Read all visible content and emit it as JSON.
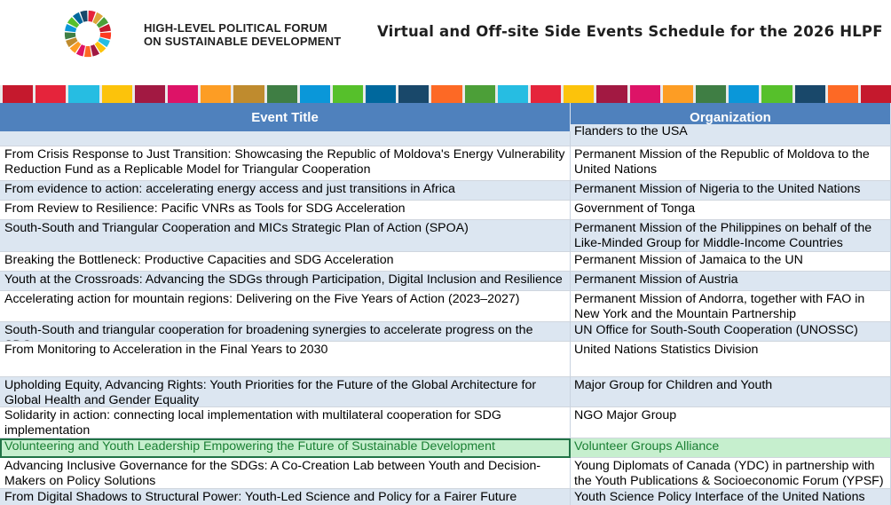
{
  "header": {
    "org_line1": "HIGH-LEVEL POLITICAL FORUM",
    "org_line2": "ON SUSTAINABLE DEVELOPMENT",
    "title": "Virtual and Off-site Side Events Schedule for the 2026 HLPF"
  },
  "sdg_colors": [
    "#e5243b",
    "#dda63a",
    "#4c9f38",
    "#c5192d",
    "#ff3a21",
    "#26bde2",
    "#fcc30b",
    "#a21942",
    "#fd6925",
    "#dd1367",
    "#fd9d24",
    "#bf8b2e",
    "#3f7e44",
    "#0a97d9",
    "#56c02b",
    "#00689d",
    "#19486a"
  ],
  "stripe_colors": [
    "#c5192d",
    "#e5243b",
    "#26bde2",
    "#fcc30b",
    "#a21942",
    "#dd1367",
    "#fd9d24",
    "#bf8b2e",
    "#3f7e44",
    "#0a97d9",
    "#56c02b",
    "#00689d",
    "#19486a",
    "#fd6925",
    "#4c9f38",
    "#26bde2",
    "#e5243b",
    "#fcc30b",
    "#a21942",
    "#dd1367",
    "#fd9d24",
    "#3f7e44",
    "#0a97d9",
    "#56c02b",
    "#19486a",
    "#fd6925",
    "#c5192d"
  ],
  "table": {
    "columns": [
      "Event Title",
      "Organization"
    ],
    "partial_top": "Flanders to the USA",
    "rows": [
      {
        "title": "From Crisis Response to Just Transition: Showcasing the Republic of Moldova's Energy Vulnerability Reduction Fund as a Replicable Model for Triangular Cooperation",
        "org": "Permanent Mission of the Republic of Moldova to the United Nations"
      },
      {
        "title": "From evidence to action: accelerating energy access and just transitions in Africa",
        "org": "Permanent Mission of Nigeria to the United Nations"
      },
      {
        "title": "From Review to Resilience: Pacific VNRs as Tools for SDG Acceleration",
        "org": "Government of Tonga"
      },
      {
        "title": "South-South and Triangular Cooperation and MICs Strategic Plan of Action (SPOA)",
        "org": "Permanent Mission of the Philippines on behalf of the Like-Minded Group for Middle-Income Countries"
      },
      {
        "title": "Breaking the Bottleneck: Productive Capacities and SDG Acceleration",
        "org": "Permanent Mission of Jamaica to the UN"
      },
      {
        "title": "Youth at the Crossroads: Advancing the SDGs through Participation, Digital Inclusion and Resilience",
        "org": "Permanent Mission of Austria"
      },
      {
        "title": "Accelerating action for mountain regions: Delivering on the Five Years of Action (2023–2027)",
        "org": "Permanent Mission of Andorra, together with FAO in New York and the Mountain Partnership"
      },
      {
        "title": "South-South and triangular cooperation for broadening synergies to accelerate progress on the SDGs",
        "org": "UN Office for South-South Cooperation (UNOSSC)"
      },
      {
        "title": "From Monitoring to Acceleration in the Final Years to 2030",
        "org": "United Nations Statistics Division"
      },
      {
        "title": "Upholding Equity, Advancing Rights: Youth Priorities for the Future of the Global Architecture for Global Health and Gender Equality",
        "org": "Major Group for Children and Youth"
      },
      {
        "title": "Solidarity in action: connecting local implementation with multilateral cooperation for SDG implementation",
        "org": "NGO Major Group"
      },
      {
        "title": "Volunteering and Youth Leadership Empowering the Future of Sustainable Development",
        "org": "Volunteer Groups Alliance"
      },
      {
        "title": "Advancing Inclusive Governance for the SDGs: A Co-Creation Lab between Youth and Decision-Makers on Policy Solutions",
        "org": "Young Diplomats of Canada (YDC) in partnership with the Youth Publications & Socioeconomic Forum (YPSF)"
      },
      {
        "title": "From Digital Shadows to Structural Power: Youth-Led Science and Policy for a Fairer Future",
        "org": "Youth Science Policy Interface of the United Nations"
      }
    ]
  }
}
